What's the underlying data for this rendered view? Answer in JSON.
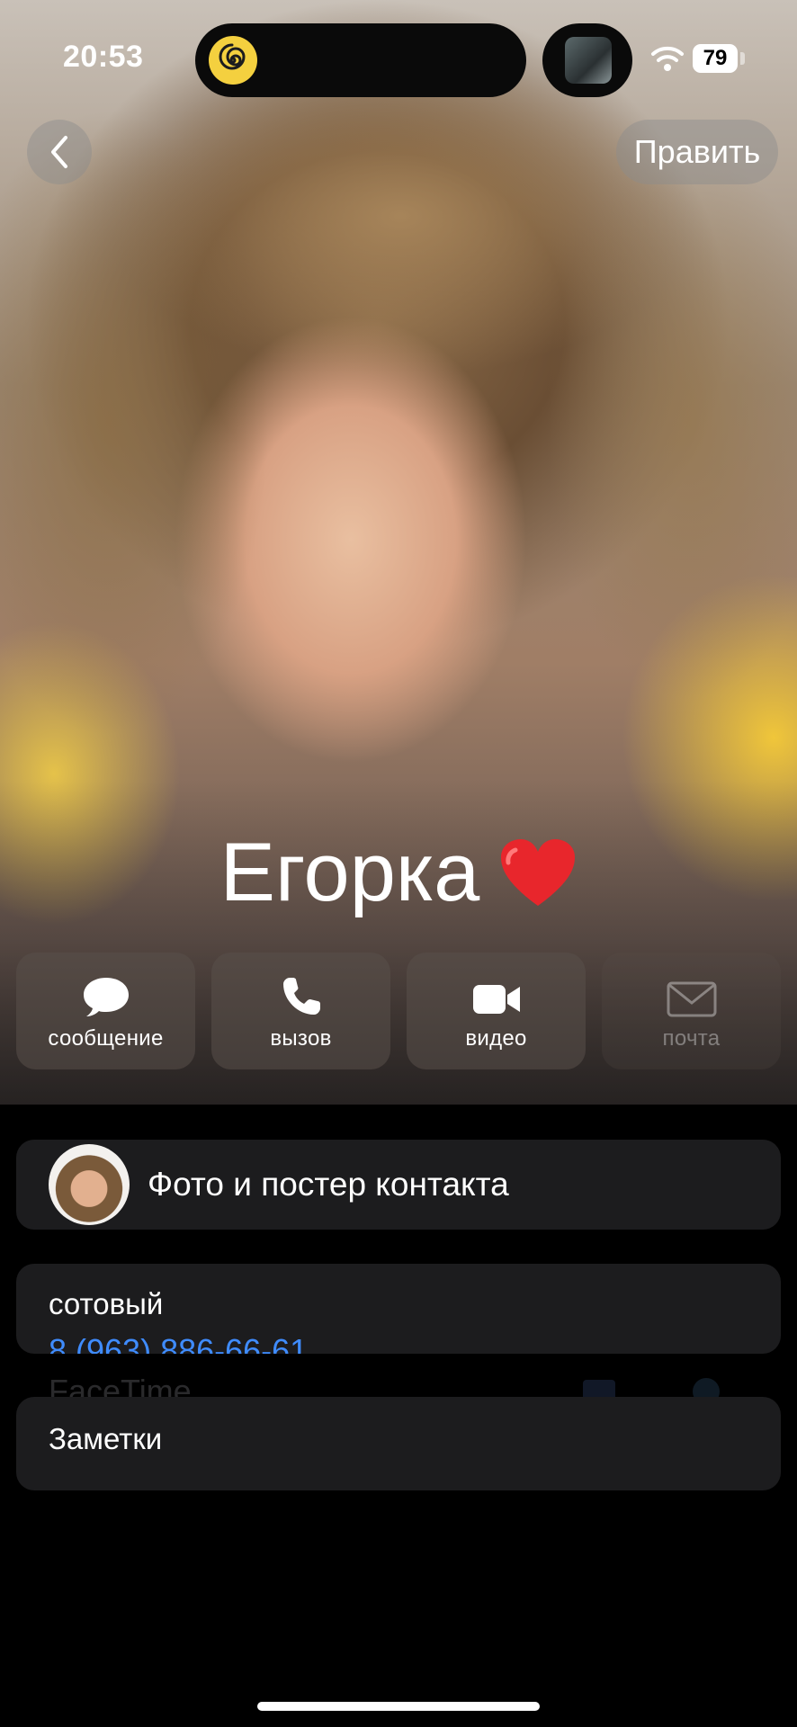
{
  "status_bar": {
    "time": "20:53",
    "battery": "79"
  },
  "nav": {
    "edit_label": "Править"
  },
  "contact": {
    "name": "Егорка"
  },
  "actions": [
    {
      "label": "сообщение",
      "icon": "message-bubble-icon",
      "enabled": true
    },
    {
      "label": "вызов",
      "icon": "phone-icon",
      "enabled": true
    },
    {
      "label": "видео",
      "icon": "video-camera-icon",
      "enabled": true
    },
    {
      "label": "почта",
      "icon": "envelope-icon",
      "enabled": false
    }
  ],
  "photo_card": {
    "label": "Фото и постер контакта"
  },
  "phone_card": {
    "label": "сотовый",
    "number": "8 (963) 886-66-61"
  },
  "facetime": {
    "label": "FaceTime"
  },
  "notes_card": {
    "label": "Заметки"
  },
  "colors": {
    "link": "#3f8cff",
    "card_bg": "#1c1c1e",
    "heart": "#e8262c"
  }
}
